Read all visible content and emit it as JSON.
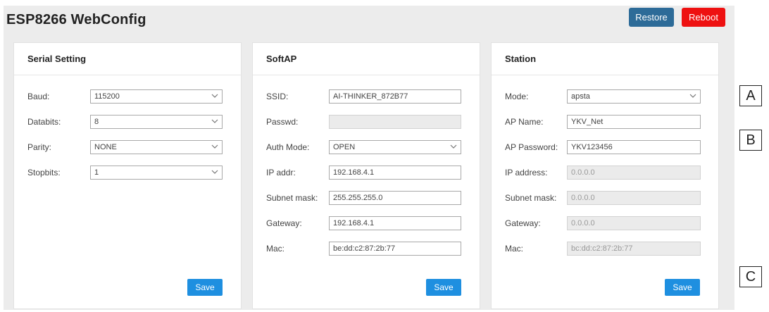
{
  "header": {
    "title": "ESP8266 WebConfig",
    "restore_label": "Restore",
    "reboot_label": "Reboot"
  },
  "serial": {
    "title": "Serial Setting",
    "baud": {
      "label": "Baud:",
      "value": "115200"
    },
    "databits": {
      "label": "Databits:",
      "value": "8"
    },
    "parity": {
      "label": "Parity:",
      "value": "NONE"
    },
    "stopbits": {
      "label": "Stopbits:",
      "value": "1"
    },
    "save_label": "Save"
  },
  "softap": {
    "title": "SoftAP",
    "ssid": {
      "label": "SSID:",
      "value": "AI-THINKER_872B77"
    },
    "passwd": {
      "label": "Passwd:",
      "value": ""
    },
    "auth_mode": {
      "label": "Auth Mode:",
      "value": "OPEN"
    },
    "ip_addr": {
      "label": "IP addr:",
      "value": "192.168.4.1"
    },
    "subnet_mask": {
      "label": "Subnet mask:",
      "value": "255.255.255.0"
    },
    "gateway": {
      "label": "Gateway:",
      "value": "192.168.4.1"
    },
    "mac": {
      "label": "Mac:",
      "value": "be:dd:c2:87:2b:77"
    },
    "save_label": "Save"
  },
  "station": {
    "title": "Station",
    "mode": {
      "label": "Mode:",
      "value": "apsta"
    },
    "ap_name": {
      "label": "AP Name:",
      "value": "YKV_Net"
    },
    "ap_password": {
      "label": "AP Password:",
      "value": "YKV123456"
    },
    "ip_address": {
      "label": "IP address:",
      "value": "0.0.0.0"
    },
    "subnet_mask": {
      "label": "Subnet mask:",
      "value": "0.0.0.0"
    },
    "gateway": {
      "label": "Gateway:",
      "value": "0.0.0.0"
    },
    "mac": {
      "label": "Mac:",
      "value": "bc:dd:c2:87:2b:77"
    },
    "save_label": "Save"
  },
  "markers": {
    "a": "A",
    "b": "B",
    "c": "C"
  }
}
